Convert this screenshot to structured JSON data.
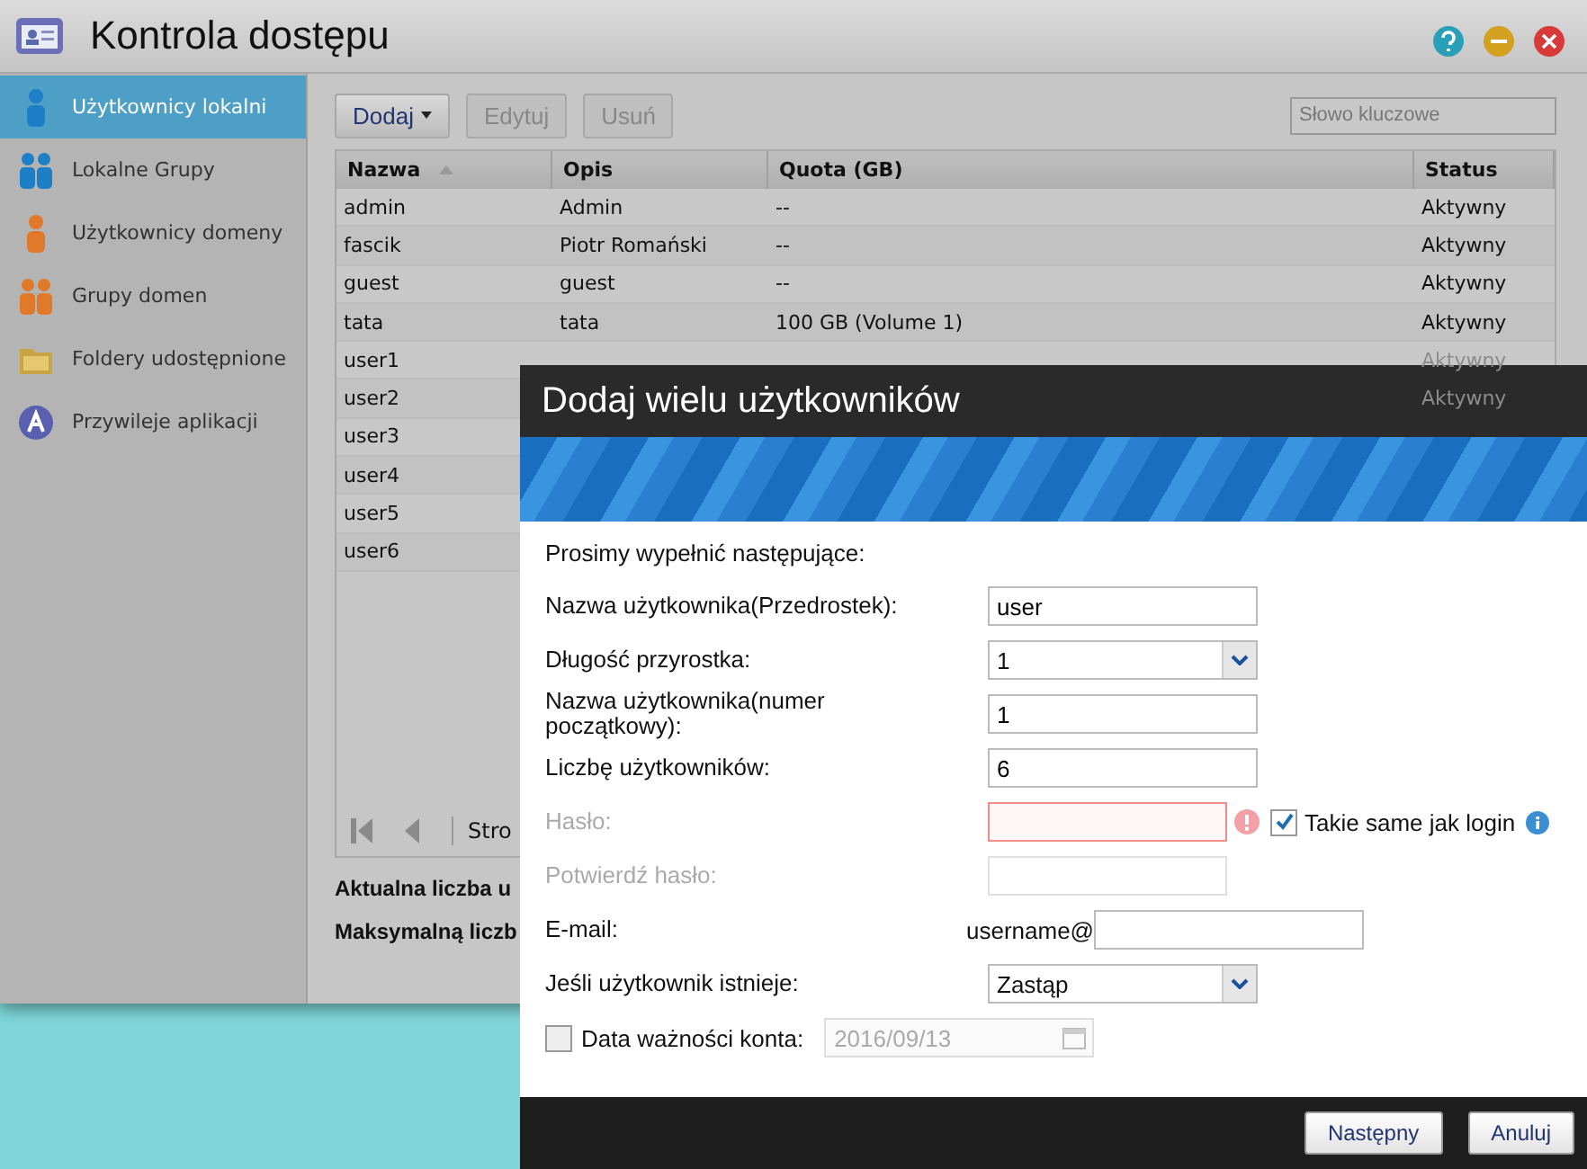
{
  "window": {
    "title": "Kontrola dostępu"
  },
  "sidebar": {
    "items": [
      {
        "label": "Użytkownicy lokalni",
        "selected": true
      },
      {
        "label": "Lokalne Grupy",
        "selected": false
      },
      {
        "label": "Użytkownicy domeny",
        "selected": false
      },
      {
        "label": "Grupy domen",
        "selected": false
      },
      {
        "label": "Foldery udostępnione",
        "selected": false
      },
      {
        "label": "Przywileje aplikacji",
        "selected": false
      }
    ]
  },
  "toolbar": {
    "buttons": [
      {
        "label": "Dodaj",
        "disabled": false,
        "dropdown": true
      },
      {
        "label": "Edytuj",
        "disabled": true,
        "dropdown": false
      },
      {
        "label": "Usuń",
        "disabled": true,
        "dropdown": false
      }
    ],
    "search": {
      "placeholder": "Słowo kluczowe"
    }
  },
  "table": {
    "columns": [
      {
        "label": "Nazwa",
        "sorted": true
      },
      {
        "label": "Opis",
        "sorted": false
      },
      {
        "label": "Quota (GB)",
        "sorted": false
      },
      {
        "label": "Status",
        "sorted": false
      }
    ],
    "rows": [
      {
        "name": "admin",
        "description": "Admin",
        "quota": "--",
        "status": "Aktywny"
      },
      {
        "name": "fascik",
        "description": "Piotr Romański",
        "quota": "--",
        "status": "Aktywny"
      },
      {
        "name": "guest",
        "description": "guest",
        "quota": "--",
        "status": "Aktywny"
      },
      {
        "name": "tata",
        "description": "tata",
        "quota": "100 GB (Volume 1)",
        "status": "Aktywny"
      },
      {
        "name": "user1",
        "status": "Aktywny"
      },
      {
        "name": "user2",
        "status": "Aktywny"
      },
      {
        "name": "user3"
      },
      {
        "name": "user4"
      },
      {
        "name": "user5"
      },
      {
        "name": "user6"
      }
    ]
  },
  "pager": {
    "label": "Stro"
  },
  "stats": [
    "Aktualna liczba u",
    "Maksymalną liczb"
  ],
  "dialog": {
    "title": "Dodaj wielu użytkowników",
    "intro": "Prosimy wypełnić następujące:",
    "fields": [
      {
        "kind": "text",
        "label": "Nazwa użytkownika(Przedrostek):",
        "value": "user"
      },
      {
        "kind": "select",
        "label": "Długość przyrostka:",
        "value": "1"
      },
      {
        "kind": "text",
        "label": "Nazwa użytkownika(numer początkowy):",
        "value": "1"
      },
      {
        "kind": "text",
        "label": "Liczbę użytkowników:",
        "value": "6"
      },
      {
        "kind": "password",
        "label": "Hasło:",
        "disabled": true,
        "error": true,
        "option": {
          "label": "Takie same jak login",
          "checked": true
        }
      },
      {
        "kind": "password",
        "label": "Potwierdź hasło:",
        "disabled": true,
        "error": false
      },
      {
        "kind": "email",
        "label": "E-mail:",
        "prefix": "username@"
      },
      {
        "kind": "select",
        "label": "Jeśli użytkownik istnieje:",
        "value": "Zastąp"
      },
      {
        "kind": "date",
        "label": "Data ważności konta:",
        "checked": false,
        "value": "2016/09/13"
      }
    ],
    "buttons": [
      "Następny",
      "Anuluj"
    ]
  }
}
